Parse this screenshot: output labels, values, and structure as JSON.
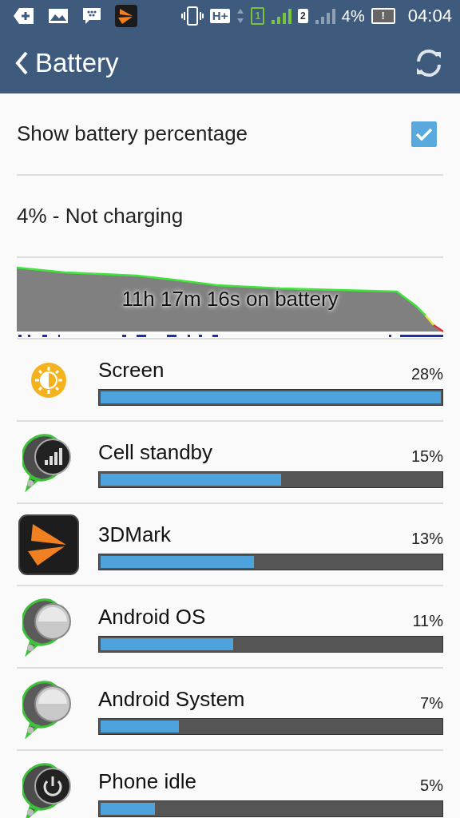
{
  "status_bar": {
    "network": "H+",
    "sim_1": "1",
    "sim_2": "2",
    "battery_percent": "4%",
    "battery_mark": "!",
    "time": "04:04"
  },
  "app_bar": {
    "title": "Battery"
  },
  "settings": {
    "label": "Show battery percentage",
    "checked": true
  },
  "charge_status": "4% - Not charging",
  "history": {
    "caption": "11h 17m 16s on battery"
  },
  "usage": [
    {
      "kind": "sun",
      "name": "Screen",
      "percent": "28%",
      "level": 1.0
    },
    {
      "kind": "signal",
      "name": "Cell standby",
      "percent": "15%",
      "level": 0.53
    },
    {
      "kind": "app",
      "name": "3DMark",
      "percent": "13%",
      "level": 0.45
    },
    {
      "kind": "gear",
      "name": "Android OS",
      "percent": "11%",
      "level": 0.39
    },
    {
      "kind": "gear",
      "name": "Android System",
      "percent": "7%",
      "level": 0.23
    },
    {
      "kind": "power",
      "name": "Phone idle",
      "percent": "5%",
      "level": 0.16
    }
  ]
}
